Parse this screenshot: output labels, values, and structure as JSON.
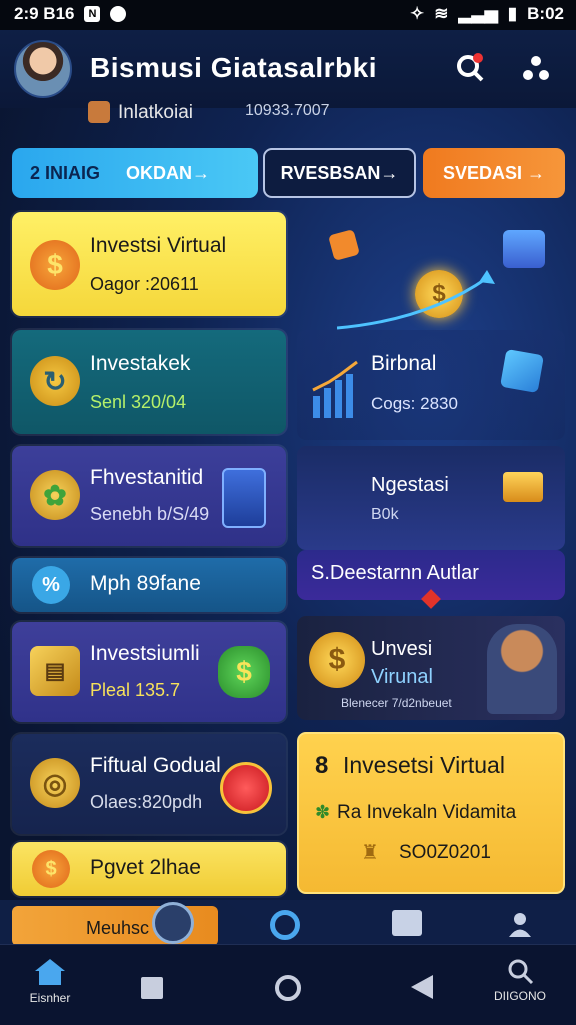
{
  "status_bar": {
    "time_left": "2:9 B16",
    "time_right": "B:02"
  },
  "header": {
    "title": "Bismusi Giatasalrbki"
  },
  "subheader": {
    "label": "Inlatkoiai",
    "value": "10933.7007"
  },
  "tabs": [
    {
      "label": "2 INIAIG",
      "action": "OKDAN→"
    },
    {
      "label": "RVESBSAN→"
    },
    {
      "label": "SVEDASI →"
    }
  ],
  "cards": [
    {
      "title": "Investsi Virtual",
      "subtitle": "Oagor :20611",
      "icon": "dollar-coin-icon"
    },
    {
      "title": "Investakek",
      "subtitle": "Senl 320/04",
      "icon": "refresh-coin-icon"
    },
    {
      "title": "Fhvestanitid",
      "subtitle": "Senebh b/S/49",
      "icon": "plant-coins-icon"
    },
    {
      "title": "Mph 89fane",
      "subtitle": "",
      "icon": "percent-icon"
    },
    {
      "title": "Investsiumli",
      "subtitle": "Pleal 135.7",
      "icon": "money-bag-icon"
    },
    {
      "title": "Fiftual Godual",
      "subtitle": "Olaes:820pdh",
      "icon": "coins-icon"
    },
    {
      "title": "Pgvet 2lhae",
      "subtitle": "",
      "icon": "dollar-coin-icon"
    }
  ],
  "right_panels": {
    "chart_card": {
      "title": "Birbnal",
      "subtitle": "Cogs: 2830"
    },
    "nested_card": {
      "title": "Ngestasi",
      "subtitle": "B0k"
    },
    "banner_caption": "S.Deestarnn Autlar",
    "promo_card": {
      "title": "Unvesi",
      "subtitle": "Virunal",
      "caption": "Blenecer 7/d2nbeuet"
    },
    "feature_card": {
      "title": "Invesetsi Virtual",
      "line": "Ra Invekaln Vidamita",
      "value": "SO0Z0201"
    }
  },
  "midbar": {
    "label": "Meuhsc"
  },
  "bottom_nav": [
    {
      "label": "Eisnher",
      "icon": "home-icon"
    },
    {
      "label": "",
      "icon": "square-icon"
    },
    {
      "label": "",
      "icon": "circle-icon"
    },
    {
      "label": "",
      "icon": "back-icon"
    },
    {
      "label": "DIIGONO",
      "icon": "search-icon"
    }
  ]
}
